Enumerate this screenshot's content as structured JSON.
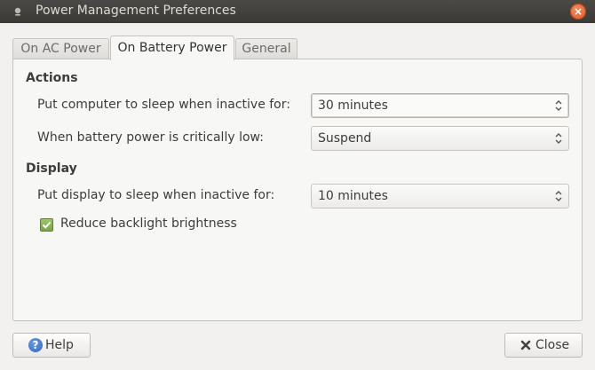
{
  "window": {
    "title": "Power Management Preferences",
    "close_glyph": "×"
  },
  "tabs": [
    {
      "label": "On AC Power",
      "active": false
    },
    {
      "label": "On Battery Power",
      "active": true
    },
    {
      "label": "General",
      "active": false
    }
  ],
  "actions": {
    "title": "Actions",
    "sleep_label": "Put computer to sleep when inactive for:",
    "sleep_value": "30 minutes",
    "critical_label": "When battery power is critically low:",
    "critical_value": "Suspend"
  },
  "display": {
    "title": "Display",
    "sleep_label": "Put display to sleep when inactive for:",
    "sleep_value": "10 minutes",
    "backlight_label": "Reduce backlight brightness",
    "backlight_checked": true
  },
  "buttons": {
    "help_label": "Help",
    "help_glyph": "?",
    "close_label": "Close"
  },
  "colors": {
    "close_button": "#e05a2c",
    "checkbox": "#79a544",
    "help_icon": "#2f66c0"
  }
}
